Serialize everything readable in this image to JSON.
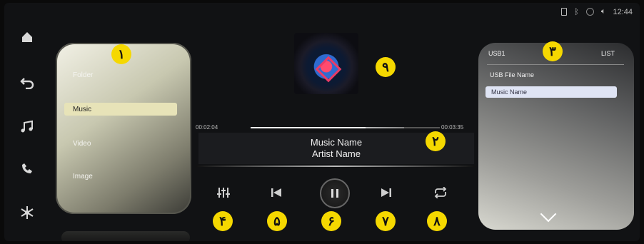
{
  "status": {
    "time": "12:44",
    "icons": [
      "sd-card-icon",
      "bluetooth-icon",
      "circle-icon",
      "volume-icon"
    ]
  },
  "nav": {
    "items": [
      {
        "name": "home-icon",
        "glyph": "⌂"
      },
      {
        "name": "back-icon",
        "glyph": "↩"
      },
      {
        "name": "music-icon",
        "glyph": "♫"
      },
      {
        "name": "phone-icon",
        "glyph": "✆"
      },
      {
        "name": "climate-icon",
        "glyph": "❄"
      }
    ]
  },
  "source_menu": {
    "items": [
      "Folder",
      "Music",
      "Video",
      "Image"
    ],
    "selected": "Music"
  },
  "player": {
    "elapsed": "00:02:04",
    "total": "00:03:35",
    "progress_fraction": 0.75,
    "track_title": "Music Name",
    "artist": "Artist Name"
  },
  "controls": {
    "eq_glyph": "⫶",
    "prev_glyph": "⏮",
    "pause_glyph": "❚❚",
    "next_glyph": "⏭",
    "repeat_glyph": "⟳"
  },
  "file_panel": {
    "tab_source": "USB1",
    "tab_list": "LIST",
    "file_name": "USB File Name",
    "selected_item": "Music Name"
  },
  "badges": {
    "b1": "۱",
    "b2": "۲",
    "b3": "۳",
    "b4": "۴",
    "b5": "۵",
    "b6": "۶",
    "b7": "۷",
    "b8": "۸",
    "b9": "۹"
  }
}
